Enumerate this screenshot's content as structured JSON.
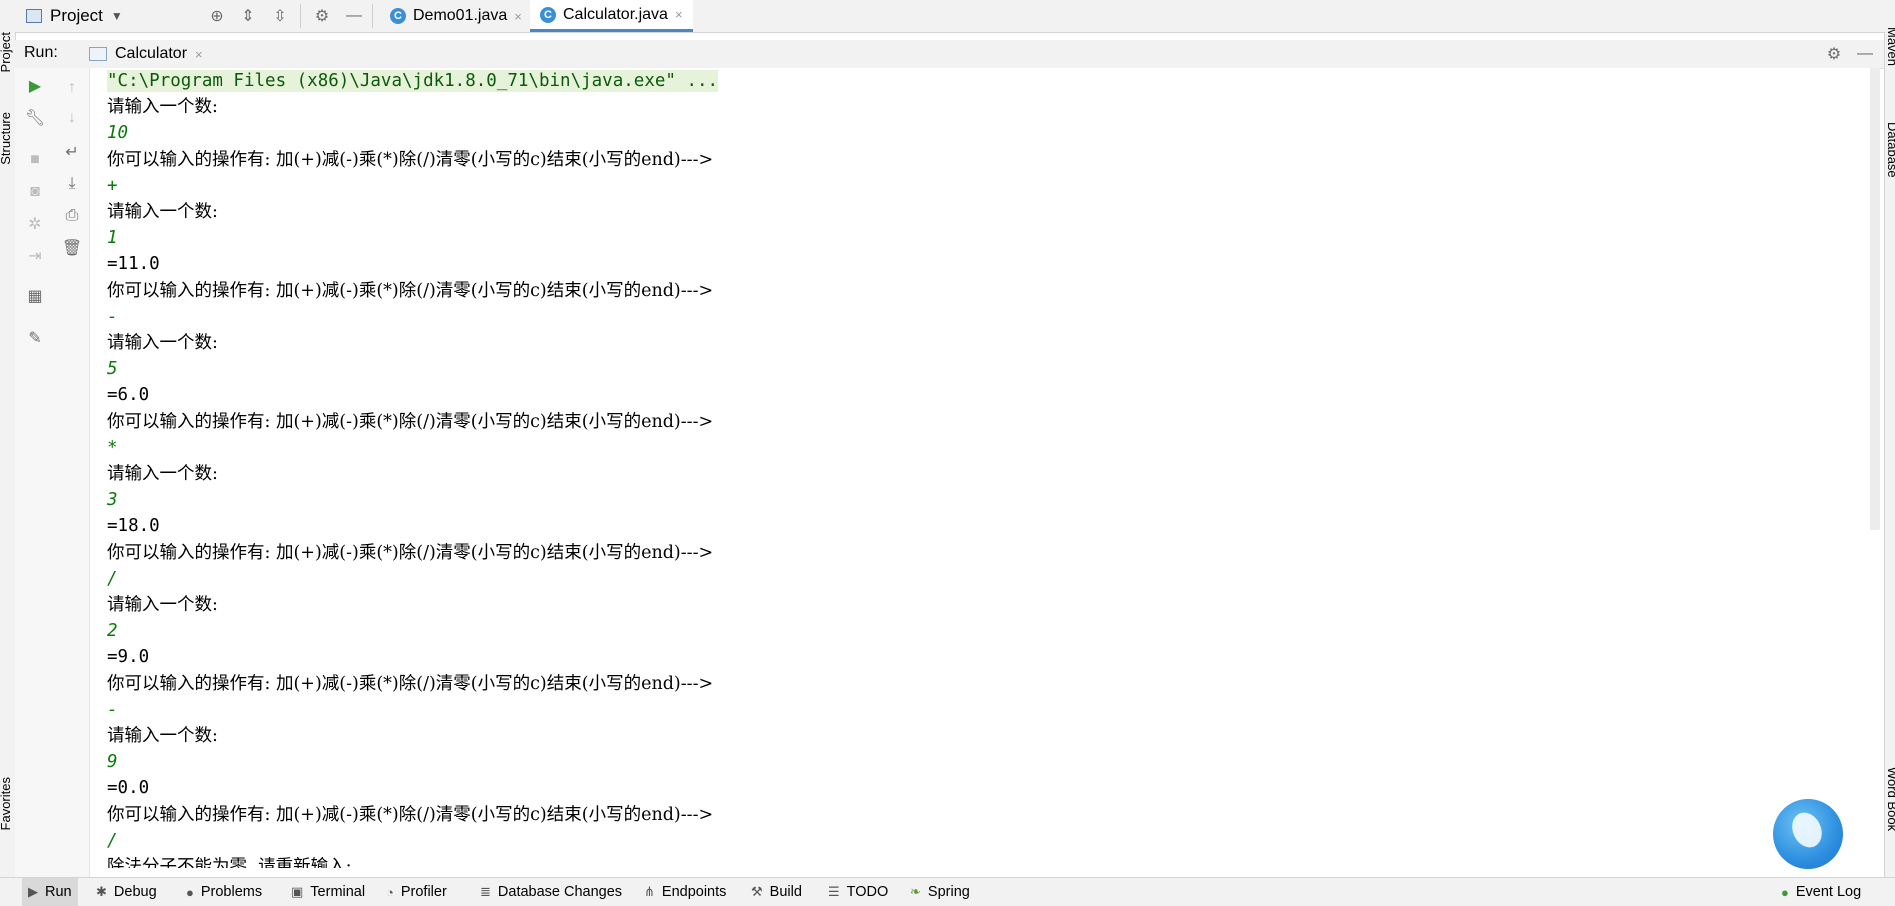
{
  "topbar": {
    "project_label": "Project",
    "tabs": [
      {
        "label": "Demo01.java",
        "icon": "c-class-icon",
        "close": "×"
      },
      {
        "label": "Calculator.java",
        "icon": "c-class-icon",
        "close": "×",
        "active": true
      }
    ]
  },
  "side_labels": {
    "left": [
      "Project",
      "Structure",
      "Favorites"
    ],
    "right": [
      "Maven",
      "Database",
      "Word Book"
    ]
  },
  "run": {
    "label": "Run:",
    "tab_label": "Calculator",
    "tab_close": "×"
  },
  "console": {
    "lines": [
      {
        "type": "cmd",
        "text": "\"C:\\Program Files (x86)\\Java\\jdk1.8.0_71\\bin\\java.exe\" ..."
      },
      {
        "type": "out",
        "text": "请输入一个数:"
      },
      {
        "type": "inp",
        "text": "10"
      },
      {
        "type": "out",
        "text": "你可以输入的操作有: 加(+)减(-)乘(*)除(/)清零(小写的c)结束(小写的end)--->"
      },
      {
        "type": "inp",
        "text": "+"
      },
      {
        "type": "out",
        "text": "请输入一个数:"
      },
      {
        "type": "inp",
        "text": "1"
      },
      {
        "type": "out",
        "text": "=11.0"
      },
      {
        "type": "out",
        "text": "你可以输入的操作有: 加(+)减(-)乘(*)除(/)清零(小写的c)结束(小写的end)--->"
      },
      {
        "type": "inp",
        "text": "-"
      },
      {
        "type": "out",
        "text": "请输入一个数:"
      },
      {
        "type": "inp",
        "text": "5"
      },
      {
        "type": "out",
        "text": "=6.0"
      },
      {
        "type": "out",
        "text": "你可以输入的操作有: 加(+)减(-)乘(*)除(/)清零(小写的c)结束(小写的end)--->"
      },
      {
        "type": "inp",
        "text": "*"
      },
      {
        "type": "out",
        "text": "请输入一个数:"
      },
      {
        "type": "inp",
        "text": "3"
      },
      {
        "type": "out",
        "text": "=18.0"
      },
      {
        "type": "out",
        "text": "你可以输入的操作有: 加(+)减(-)乘(*)除(/)清零(小写的c)结束(小写的end)--->"
      },
      {
        "type": "inp",
        "text": "/"
      },
      {
        "type": "out",
        "text": "请输入一个数:"
      },
      {
        "type": "inp",
        "text": "2"
      },
      {
        "type": "out",
        "text": "=9.0"
      },
      {
        "type": "out",
        "text": "你可以输入的操作有: 加(+)减(-)乘(*)除(/)清零(小写的c)结束(小写的end)--->"
      },
      {
        "type": "inp",
        "text": "-"
      },
      {
        "type": "out",
        "text": "请输入一个数:"
      },
      {
        "type": "inp",
        "text": "9"
      },
      {
        "type": "out",
        "text": "=0.0"
      },
      {
        "type": "out",
        "text": "你可以输入的操作有: 加(+)减(-)乘(*)除(/)清零(小写的c)结束(小写的end)--->"
      },
      {
        "type": "inp",
        "text": "/"
      },
      {
        "type": "out",
        "text": "除法分子不能为零, 请重新输入:"
      }
    ]
  },
  "bottombar": {
    "items": [
      {
        "label": "Run",
        "icon": "play-icon",
        "active": true
      },
      {
        "label": "Debug",
        "icon": "bug-icon"
      },
      {
        "label": "Problems",
        "icon": "info-icon"
      },
      {
        "label": "Terminal",
        "icon": "terminal-icon"
      },
      {
        "label": "Profiler",
        "icon": "profiler-icon"
      },
      {
        "label": "Database Changes",
        "icon": "database-changes-icon"
      },
      {
        "label": "Endpoints",
        "icon": "endpoints-icon"
      },
      {
        "label": "Build",
        "icon": "hammer-icon"
      },
      {
        "label": "TODO",
        "icon": "list-icon"
      },
      {
        "label": "Spring",
        "icon": "spring-leaf-icon"
      }
    ],
    "event_log": "Event Log"
  },
  "colors": {
    "cmd_bg": "#e6f2da",
    "input_text": "#0a7a0a",
    "accent": "#4a86c8"
  }
}
